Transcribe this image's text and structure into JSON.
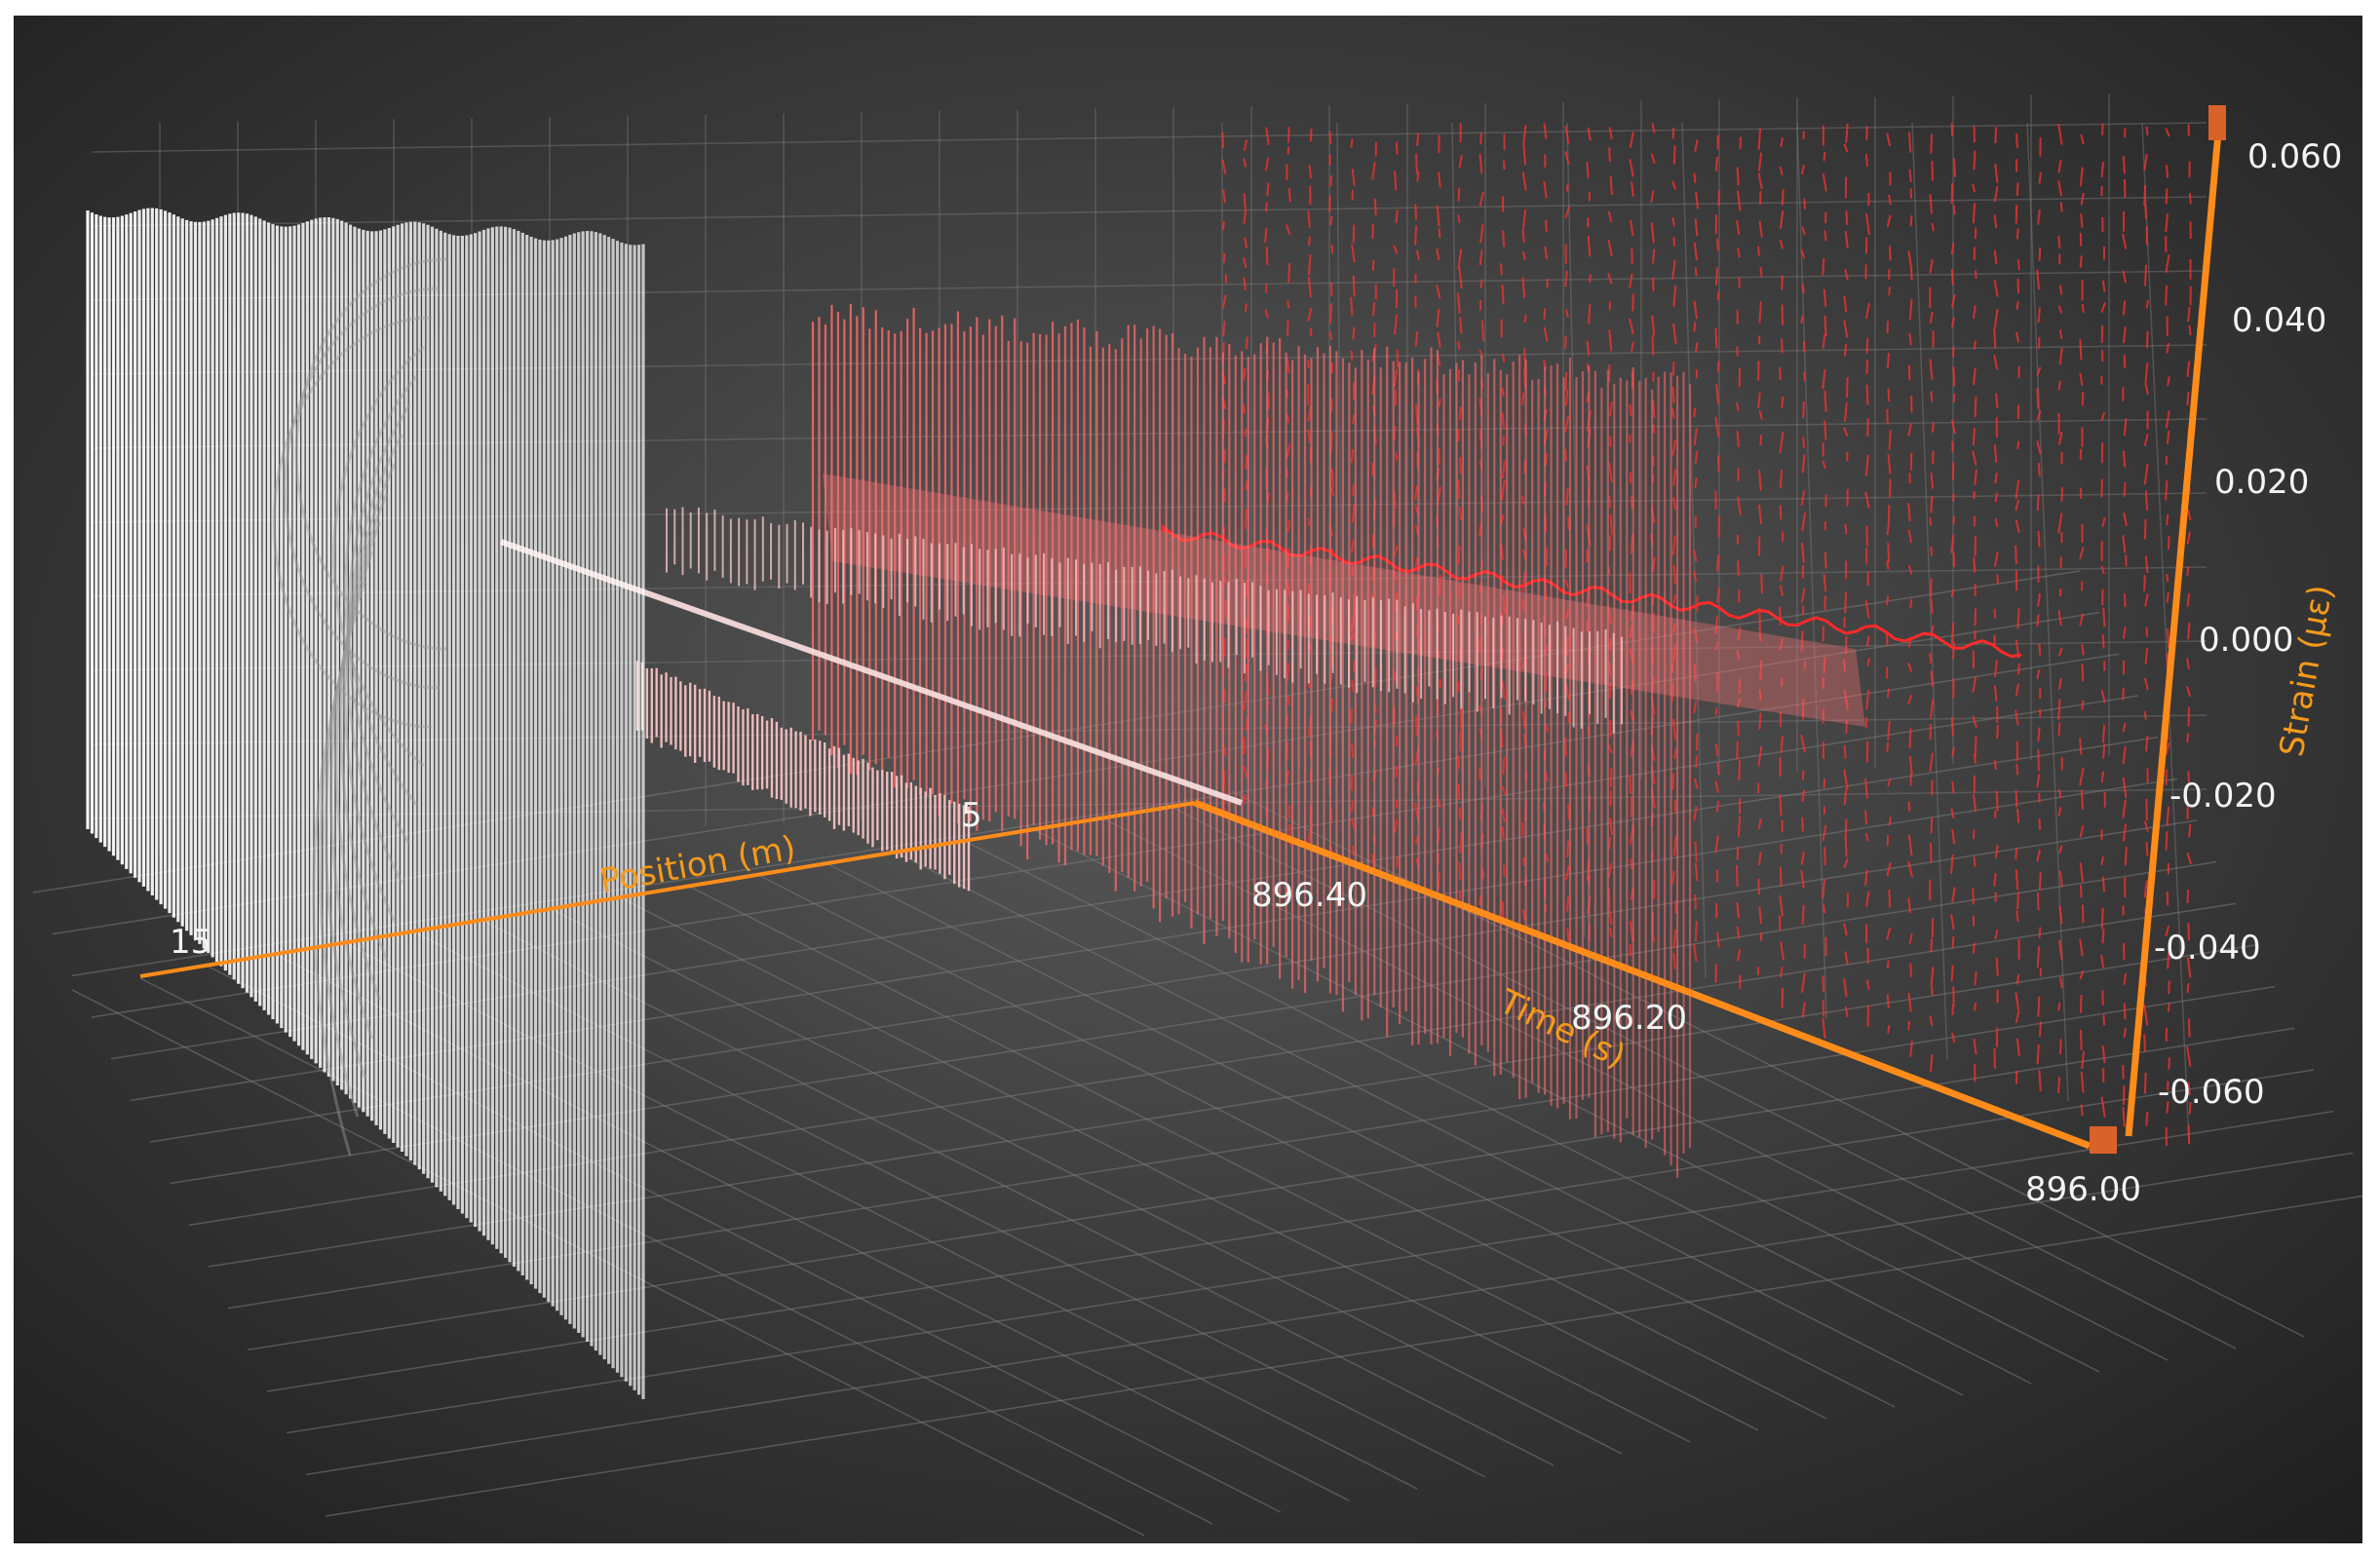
{
  "chart_data": {
    "type": "3d-line",
    "title": "",
    "axes": {
      "x": {
        "label": "Position (m)",
        "ticks": [
          "15",
          "5"
        ]
      },
      "y": {
        "label": "Strain (µε)",
        "ticks": [
          "0.060",
          "0.040",
          "0.020",
          "0.000",
          "-0.020",
          "-0.040",
          "-0.060"
        ],
        "ylim": [
          -0.07,
          0.07
        ]
      },
      "z": {
        "label": "Time (s)",
        "ticks": [
          "896.40",
          "896.20",
          "896.00"
        ],
        "zlim": [
          896.0,
          896.5
        ]
      }
    },
    "grid": true,
    "colors": {
      "background_center": "#5a5a5a",
      "background_edge": "#1e1e1e",
      "grid": "#7a7a7a",
      "axis": "#ff8c1a",
      "near_series": "#ffffff",
      "mid_series": "#ffc8c8",
      "far_series": "#ff6a6a",
      "back_series": "#ff3030"
    },
    "series": [
      {
        "position_m": 18,
        "style": "dense-envelope"
      },
      {
        "position_m": 12,
        "style": "thin-band"
      },
      {
        "position_m": 8,
        "style": "thin-band"
      },
      {
        "position_m": 4,
        "style": "dense-envelope"
      },
      {
        "position_m": 1,
        "style": "sparse-ticks"
      }
    ]
  }
}
